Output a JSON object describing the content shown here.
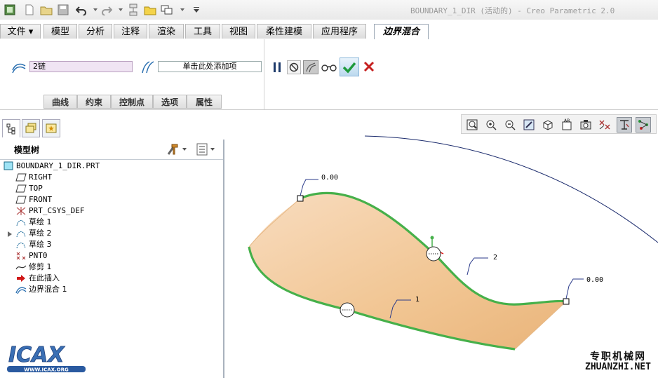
{
  "window": {
    "title": "BOUNDARY_1_DIR (活动的) - Creo Parametric 2.0"
  },
  "quick_toolbar": {
    "icons": [
      "app-icon",
      "new-file-icon",
      "open-folder-icon",
      "save-icon",
      "undo-icon",
      "redo-icon",
      "regenerate-icon",
      "window-icon",
      "close-window-icon",
      "customize-icon"
    ]
  },
  "tabs": [
    {
      "label": "文件 ▾"
    },
    {
      "label": "模型"
    },
    {
      "label": "分析"
    },
    {
      "label": "注释"
    },
    {
      "label": "渲染"
    },
    {
      "label": "工具"
    },
    {
      "label": "视图"
    },
    {
      "label": "柔性建模"
    },
    {
      "label": "应用程序"
    },
    {
      "label": "边界混合"
    }
  ],
  "ribbon": {
    "first_dir_value": "2链",
    "second_dir_placeholder": "单击此处添加项",
    "subtabs": [
      {
        "label": "曲线"
      },
      {
        "label": "约束"
      },
      {
        "label": "控制点"
      },
      {
        "label": "选项"
      },
      {
        "label": "属性"
      }
    ]
  },
  "model_tree": {
    "title": "模型树",
    "items": [
      {
        "label": "BOUNDARY_1_DIR.PRT",
        "icon": "part-icon"
      },
      {
        "label": "RIGHT",
        "icon": "datum-plane-icon"
      },
      {
        "label": "TOP",
        "icon": "datum-plane-icon"
      },
      {
        "label": "FRONT",
        "icon": "datum-plane-icon"
      },
      {
        "label": "PRT_CSYS_DEF",
        "icon": "csys-icon"
      },
      {
        "label": "草绘 1",
        "icon": "sketch-icon"
      },
      {
        "label": "草绘 2",
        "icon": "sketch-icon"
      },
      {
        "label": "草绘 3",
        "icon": "sketch-icon"
      },
      {
        "label": "PNT0",
        "icon": "datum-point-icon"
      },
      {
        "label": "修剪 1",
        "icon": "trim-icon"
      },
      {
        "label": "在此插入",
        "icon": "insert-arrow-icon"
      },
      {
        "label": "边界混合 1",
        "icon": "boundary-blend-icon"
      }
    ]
  },
  "viewport": {
    "labels": {
      "value_top_left": "0.00",
      "value_right": "0.00",
      "curve_label_2": "2",
      "curve_label_1": "1"
    },
    "colors": {
      "surface": "#f2c99a",
      "edge": "#4caf50",
      "curve": "#1a2a6c"
    }
  },
  "watermark": {
    "logo_text": "ICAX",
    "logo_url_text": "WWW.ICAX.ORG",
    "site_cn": "专职机械网",
    "site_en": "ZHUANZHI.NET"
  }
}
